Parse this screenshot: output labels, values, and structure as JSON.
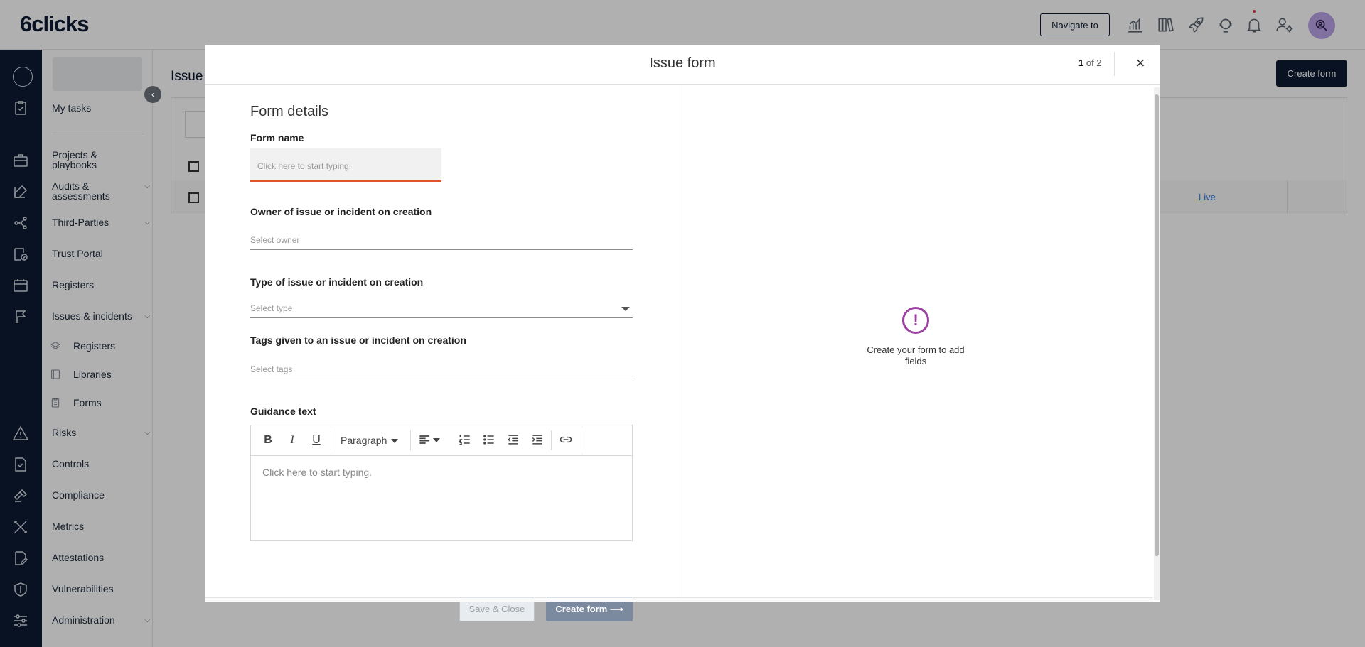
{
  "header": {
    "logo": "6clicks",
    "navigate_label": "Navigate to",
    "icons": [
      "analytics-icon",
      "library-icon",
      "rocket-icon",
      "support-icon",
      "bell-icon",
      "user-settings-icon"
    ]
  },
  "sidebar": {
    "items": [
      {
        "label": "My tasks"
      },
      {
        "label": "Projects & playbooks"
      },
      {
        "label": "Audits & assessments"
      },
      {
        "label": "Third-Parties"
      },
      {
        "label": "Trust Portal"
      },
      {
        "label": "Registers"
      },
      {
        "label": "Issues & incidents"
      },
      {
        "label": "Risks"
      },
      {
        "label": "Controls"
      },
      {
        "label": "Compliance"
      },
      {
        "label": "Metrics"
      },
      {
        "label": "Attestations"
      },
      {
        "label": "Vulnerabilities"
      },
      {
        "label": "Administration"
      }
    ],
    "subitems": [
      {
        "label": "Registers"
      },
      {
        "label": "Libraries"
      },
      {
        "label": "Forms"
      }
    ]
  },
  "page": {
    "title": "Issue",
    "create_button": "Create form",
    "row_status": "Live"
  },
  "modal": {
    "title": "Issue form",
    "pager_current": "1",
    "pager_rest": " of 2",
    "close": "×",
    "section_title": "Form details",
    "form_name_label": "Form name",
    "form_name_placeholder": "Click here to start typing.",
    "owner_label": "Owner of issue or incident on creation",
    "owner_placeholder": "Select owner",
    "type_label": "Type of issue or incident on creation",
    "type_placeholder": "Select type",
    "tags_label": "Tags given to an issue or incident on creation",
    "tags_placeholder": "Select tags",
    "guidance_label": "Guidance text",
    "editor": {
      "paragraph_label": "Paragraph",
      "placeholder": "Click here to start typing.",
      "bold": "B",
      "italic": "I",
      "underline": "U"
    },
    "save_close_label": "Save & Close",
    "create_form_label": "Create form",
    "empty_icon": "!",
    "empty_text": "Create your form to add fields"
  },
  "colors": {
    "navy": "#0c1b33",
    "error_underline": "#e2542c",
    "empty_icon": "#9b3fa0",
    "create_button_disabled": "#7c8aa0"
  }
}
